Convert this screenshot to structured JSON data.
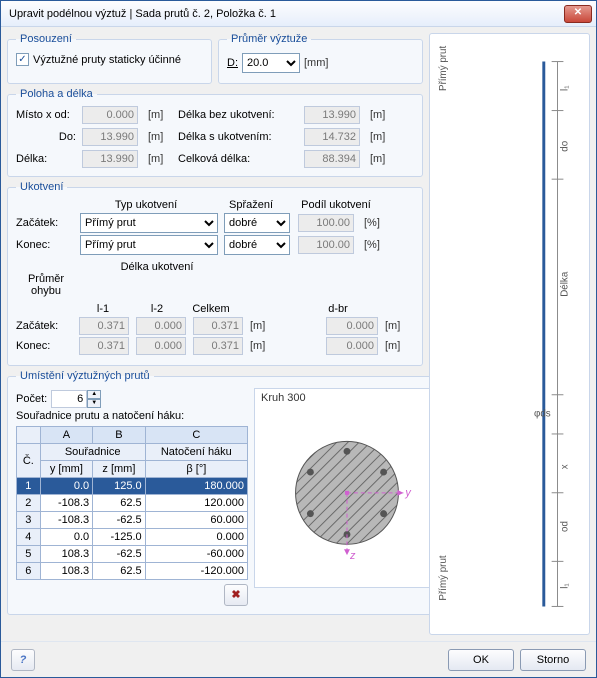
{
  "window": {
    "title": "Upravit podélnou výztuž | Sada prutů č. 2, Položka č. 1"
  },
  "assess": {
    "legend": "Posouzení",
    "check_label": "Výztužné pruty staticky účinné",
    "checked": "✓"
  },
  "diameter": {
    "legend": "Průměr výztuže",
    "label": "D:",
    "value": "20.0",
    "unit": "[mm]"
  },
  "pos": {
    "legend": "Poloha a délka",
    "misto_label": "Místo x od:",
    "misto_val": "0.000",
    "m": "[m]",
    "do_label": "Do:",
    "do_val": "13.990",
    "delka_label": "Délka:",
    "delka_val": "13.990",
    "bez_label": "Délka bez ukotvení:",
    "bez_val": "13.990",
    "suk_label": "Délka s ukotvením:",
    "suk_val": "14.732",
    "cel_label": "Celková délka:",
    "cel_val": "88.394"
  },
  "anch": {
    "legend": "Ukotvení",
    "typ": "Typ ukotvení",
    "spr": "Spřažení",
    "podil": "Podíl ukotvení",
    "zac": "Začátek:",
    "kon": "Konec:",
    "opt_primy": "Přímý prut",
    "opt_dobre": "dobré",
    "p1": "100.00",
    "p2": "100.00",
    "pct": "[%]",
    "dlu": "Délka ukotvení",
    "l1": "l-1",
    "l2": "l-2",
    "cel": "Celkem",
    "pob": "Průměr ohybu",
    "dbr": "d-br",
    "z_l1": "0.371",
    "z_l2": "0.000",
    "z_c": "0.371",
    "z_d": "0.000",
    "k_l1": "0.371",
    "k_l2": "0.000",
    "k_c": "0.371",
    "k_d": "0.000",
    "mu": "[m]"
  },
  "place": {
    "legend": "Umístění výztužných prutů",
    "pocet_label": "Počet:",
    "pocet_val": "6",
    "sour_label": "Souřadnice prutu a natočení háku:",
    "cs_title": "Kruh 300",
    "hA": "A",
    "hB": "B",
    "hC": "C",
    "sour": "Souřadnice",
    "nat": "Natočení háku",
    "c": "Č.",
    "y": "y [mm]",
    "z": "z [mm]",
    "b": "β [°]",
    "rows": [
      {
        "n": "1",
        "y": "0.0",
        "z": "125.0",
        "b": "180.000"
      },
      {
        "n": "2",
        "y": "-108.3",
        "z": "62.5",
        "b": "120.000"
      },
      {
        "n": "3",
        "y": "-108.3",
        "z": "-62.5",
        "b": "60.000"
      },
      {
        "n": "4",
        "y": "0.0",
        "z": "-125.0",
        "b": "0.000"
      },
      {
        "n": "5",
        "y": "108.3",
        "z": "-62.5",
        "b": "-60.000"
      },
      {
        "n": "6",
        "y": "108.3",
        "z": "62.5",
        "b": "-120.000"
      }
    ]
  },
  "diagram": {
    "top": "Přímý prut",
    "bot": "Přímý prut",
    "do": "do",
    "delka": "Délka",
    "ods": "φds",
    "od": "od",
    "x": "x",
    "l1t": "l₁",
    "l1b": "l₁"
  },
  "footer": {
    "ok": "OK",
    "cancel": "Storno"
  }
}
